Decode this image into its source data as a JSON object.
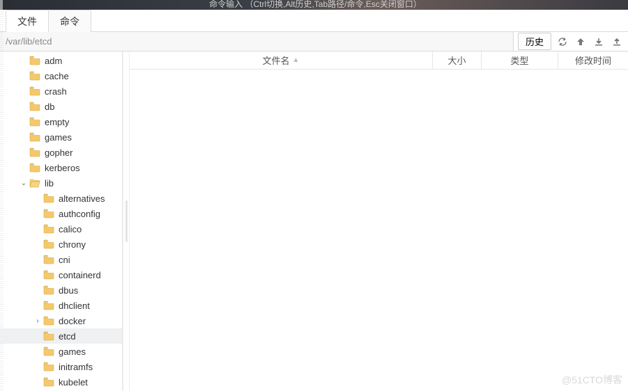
{
  "top_hint": "命令输入 （Ctrl切换,Alt历史,Tab路径/命令,Esc关闭窗口）",
  "tabs": [
    {
      "label": "文件",
      "active": true
    },
    {
      "label": "命令",
      "active": false
    }
  ],
  "path": "/var/lib/etcd",
  "history_label": "历史",
  "columns": {
    "name": "文件名",
    "size": "大小",
    "type": "类型",
    "mtime": "修改时间"
  },
  "tree": [
    {
      "label": "adm",
      "depth": 1,
      "open": false,
      "expandable": false
    },
    {
      "label": "cache",
      "depth": 1,
      "open": false,
      "expandable": false
    },
    {
      "label": "crash",
      "depth": 1,
      "open": false,
      "expandable": false
    },
    {
      "label": "db",
      "depth": 1,
      "open": false,
      "expandable": false
    },
    {
      "label": "empty",
      "depth": 1,
      "open": false,
      "expandable": false
    },
    {
      "label": "games",
      "depth": 1,
      "open": false,
      "expandable": false
    },
    {
      "label": "gopher",
      "depth": 1,
      "open": false,
      "expandable": false
    },
    {
      "label": "kerberos",
      "depth": 1,
      "open": false,
      "expandable": false
    },
    {
      "label": "lib",
      "depth": 1,
      "open": true,
      "expandable": true
    },
    {
      "label": "alternatives",
      "depth": 2,
      "open": false,
      "expandable": false
    },
    {
      "label": "authconfig",
      "depth": 2,
      "open": false,
      "expandable": false
    },
    {
      "label": "calico",
      "depth": 2,
      "open": false,
      "expandable": false
    },
    {
      "label": "chrony",
      "depth": 2,
      "open": false,
      "expandable": false
    },
    {
      "label": "cni",
      "depth": 2,
      "open": false,
      "expandable": false
    },
    {
      "label": "containerd",
      "depth": 2,
      "open": false,
      "expandable": false
    },
    {
      "label": "dbus",
      "depth": 2,
      "open": false,
      "expandable": false
    },
    {
      "label": "dhclient",
      "depth": 2,
      "open": false,
      "expandable": false
    },
    {
      "label": "docker",
      "depth": 2,
      "open": false,
      "expandable": true
    },
    {
      "label": "etcd",
      "depth": 2,
      "open": false,
      "expandable": false,
      "selected": true
    },
    {
      "label": "games",
      "depth": 2,
      "open": false,
      "expandable": false
    },
    {
      "label": "initramfs",
      "depth": 2,
      "open": false,
      "expandable": false
    },
    {
      "label": "kubelet",
      "depth": 2,
      "open": false,
      "expandable": false
    }
  ],
  "watermark": "@51CTO博客"
}
